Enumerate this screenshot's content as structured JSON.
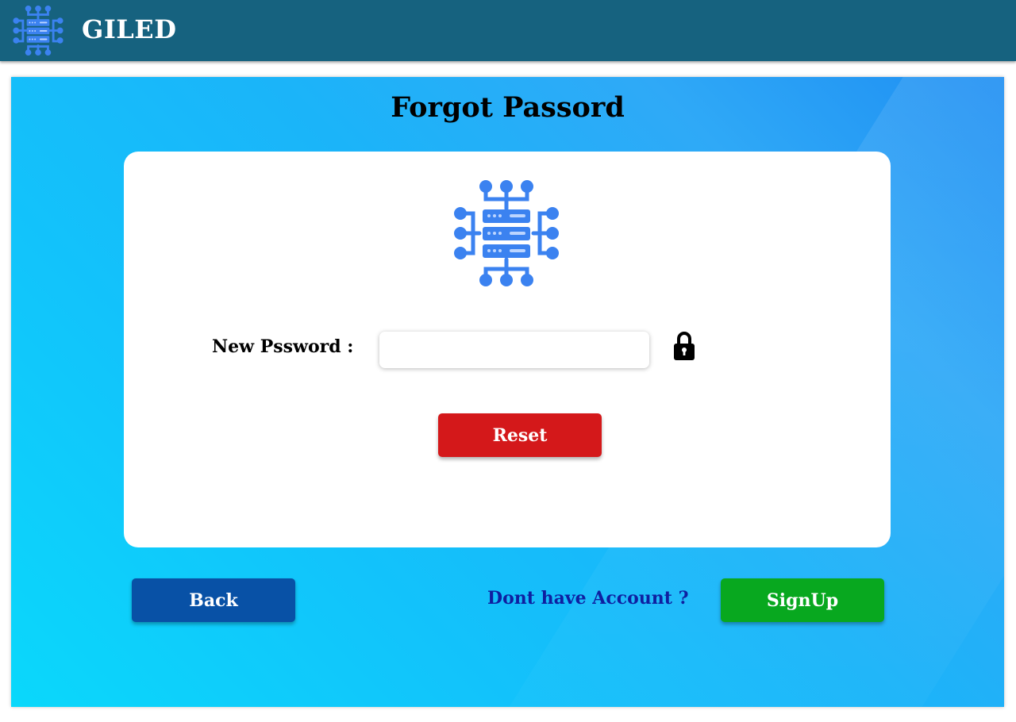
{
  "header": {
    "brand_name": "GILED",
    "logo_icon": "server-network-icon",
    "background_color": "#16627f"
  },
  "main": {
    "title": "Forgot Passord",
    "card": {
      "logo_icon": "server-network-icon",
      "new_password_label": "New Pssword :",
      "new_password_value": "",
      "lock_icon": "lock-icon",
      "reset_label": "Reset"
    },
    "footer": {
      "back_label": "Back",
      "no_account_text": "Dont have Account ?",
      "signup_label": "SignUp"
    }
  },
  "colors": {
    "reset_button": "#d4181a",
    "back_button": "#0851a6",
    "signup_button": "#08a81f",
    "icon_blue": "#3b82f0",
    "link_text": "#0f1fa0"
  }
}
